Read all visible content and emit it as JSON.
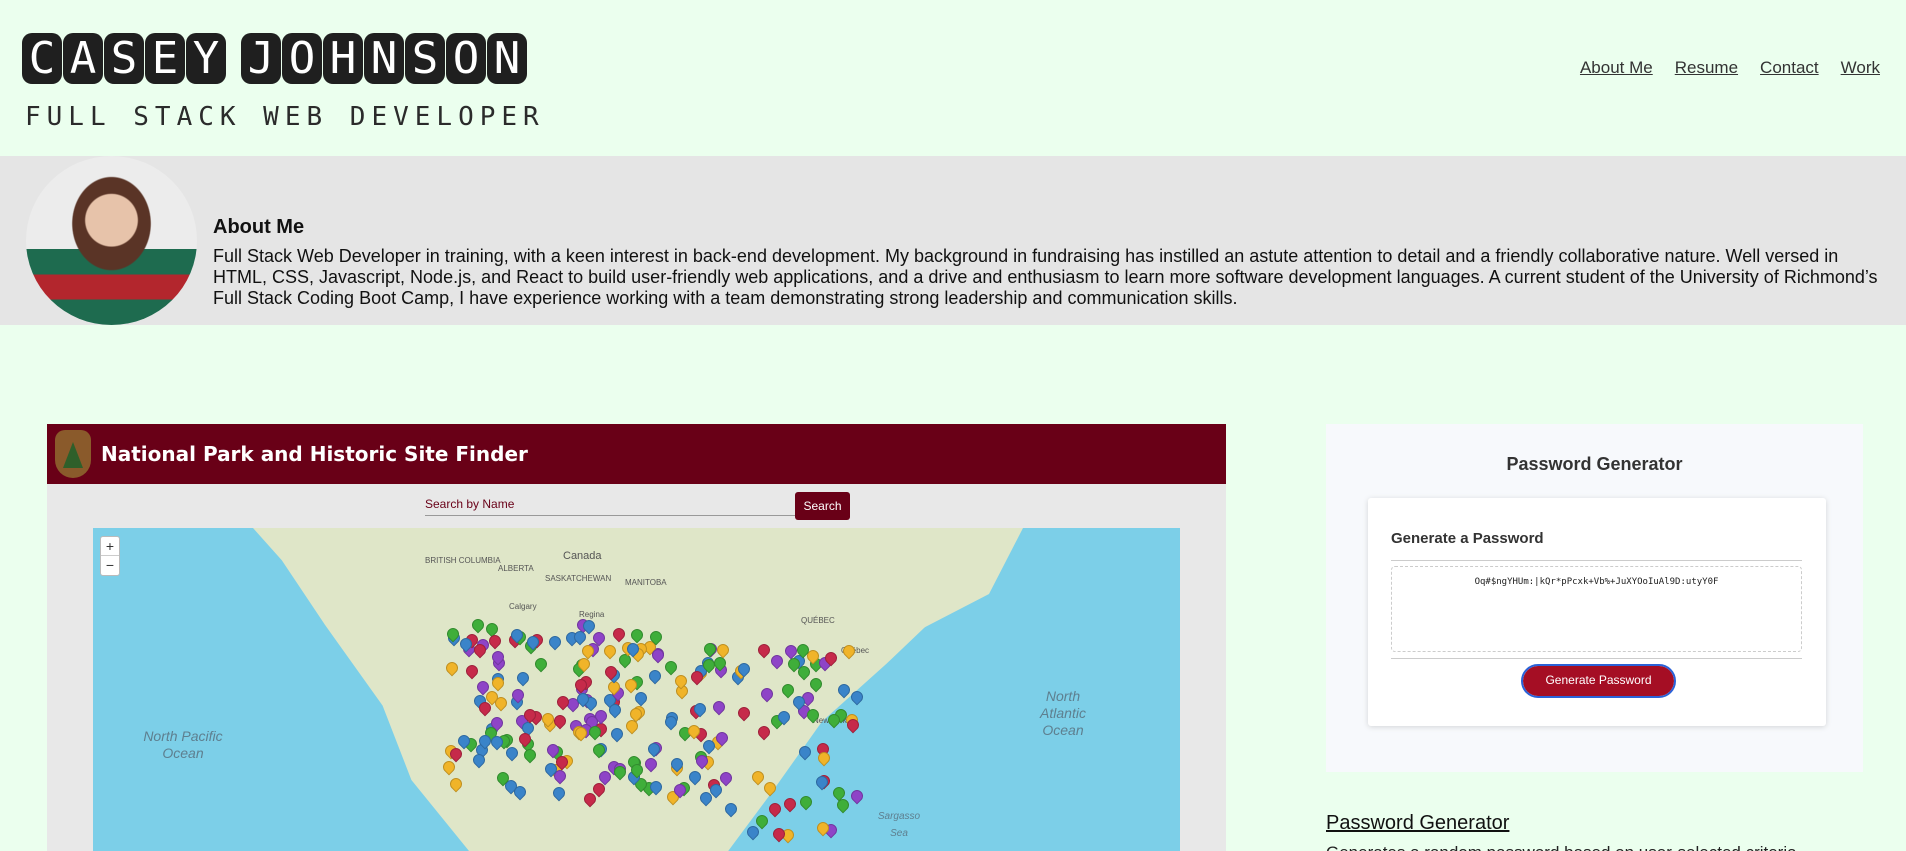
{
  "header": {
    "name_letters": [
      "C",
      "A",
      "S",
      "E",
      "Y",
      " ",
      "J",
      "O",
      "H",
      "N",
      "S",
      "O",
      "N"
    ],
    "subtitle": "FULL STACK WEB DEVELOPER",
    "nav": [
      "About Me",
      "Resume",
      "Contact",
      "Work"
    ]
  },
  "about": {
    "heading": "About Me",
    "body": "Full Stack Web Developer in training, with a keen interest in back-end development. My background in fundraising has instilled an astute attention to detail and a friendly collaborative nature. Well versed in HTML, CSS, Javascript, Node.js, and React to build user-friendly web applications, and a drive and enthusiasm to learn more software development languages. A current student of the University of Richmond’s Full Stack Coding Boot Camp, I have experience working with a team demonstrating strong leadership and communication skills."
  },
  "park": {
    "title": "National Park and Historic Site Finder",
    "search_placeholder": "Search by Name",
    "search_button": "Search",
    "zoom_in": "+",
    "zoom_out": "−",
    "map_labels": {
      "north_pacific": "North Pacific Ocean",
      "north_atlantic": "North Atlantic Ocean",
      "sargasso": "Sargasso Sea",
      "canada": "Canada",
      "british_columbia": "BRITISH COLUMBIA",
      "alberta": "ALBERTA",
      "saskatchewan": "SASKATCHEWAN",
      "manitoba": "MANITOBA",
      "quebec": "QUÉBEC",
      "calgary": "Calgary",
      "regina": "Regina",
      "quebec_city": "Québec",
      "new_york": "New York"
    },
    "pin_colors": [
      "#3a84c9",
      "#8e44c7",
      "#c62a4a",
      "#3fae3a",
      "#f0b429"
    ]
  },
  "password": {
    "title": "Password Generator",
    "card_heading": "Generate a Password",
    "generated": "Oq#$ngYHUm:|kQr*pPcxk+Vb%+JuXYOoIuAl9D:utyY0F",
    "button": "Generate Password",
    "link": "Password Generator",
    "description": "Generates a random password based on user-selected criteria"
  }
}
